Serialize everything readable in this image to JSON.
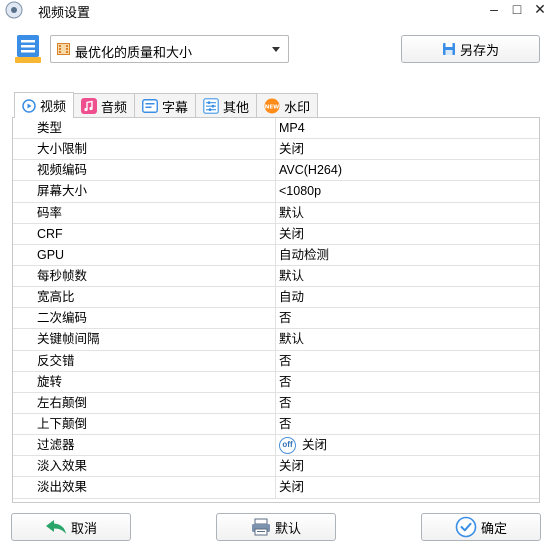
{
  "window": {
    "title": "视频设置",
    "controls": {
      "minimize": "–",
      "maximize": "□",
      "close": "✕"
    }
  },
  "preset": {
    "selected": "最优化的质量和大小"
  },
  "buttons": {
    "save_as": "另存为",
    "cancel": "取消",
    "default": "默认",
    "ok": "确定"
  },
  "tabs": [
    {
      "label": "视频",
      "icon": "video-icon"
    },
    {
      "label": "音频",
      "icon": "music-icon"
    },
    {
      "label": "字幕",
      "icon": "subtitle-icon"
    },
    {
      "label": "其他",
      "icon": "other-settings-icon"
    },
    {
      "label": "水印",
      "icon": "watermark-new-icon",
      "badge": "NEW"
    }
  ],
  "settings": [
    {
      "key": "类型",
      "value": "MP4"
    },
    {
      "key": "大小限制",
      "value": "关闭"
    },
    {
      "key": "视频编码",
      "value": "AVC(H264)"
    },
    {
      "key": "屏幕大小",
      "value": "<1080p"
    },
    {
      "key": "码率",
      "value": "默认"
    },
    {
      "key": "CRF",
      "value": "关闭"
    },
    {
      "key": "GPU",
      "value": "自动检测"
    },
    {
      "key": "每秒帧数",
      "value": "默认"
    },
    {
      "key": "宽高比",
      "value": "自动"
    },
    {
      "key": "二次编码",
      "value": "否"
    },
    {
      "key": "关键帧间隔",
      "value": "默认"
    },
    {
      "key": "反交错",
      "value": "否"
    },
    {
      "key": "旋转",
      "value": "否"
    },
    {
      "key": "左右颠倒",
      "value": "否"
    },
    {
      "key": "上下颠倒",
      "value": "否"
    },
    {
      "key": "过滤器",
      "value": "关闭",
      "badge": "off"
    },
    {
      "key": "淡入效果",
      "value": "关闭"
    },
    {
      "key": "淡出效果",
      "value": "关闭"
    }
  ],
  "colors": {
    "accent": "#3a8ee6",
    "tab_border": "#c9c9c9",
    "grid_line": "#e2e2e2"
  }
}
